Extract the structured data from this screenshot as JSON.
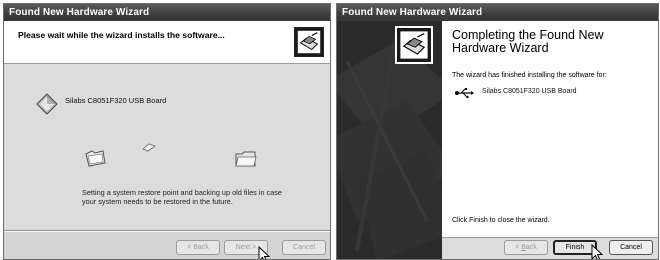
{
  "left_window": {
    "title": "Found New Hardware Wizard",
    "header_text": "Please wait while the wizard installs the software...",
    "device_name": "Silabs C8051F320 USB Board",
    "status_text": "Setting a system restore point and backing up old files in case your system needs to be restored in the future.",
    "buttons": {
      "back": {
        "label": "< Back",
        "enabled": false
      },
      "next": {
        "label": "Next >",
        "enabled": false
      },
      "cancel": {
        "label": "Cancel",
        "enabled": false
      }
    }
  },
  "right_window": {
    "title": "Found New Hardware Wizard",
    "heading": "Completing the Found New Hardware Wizard",
    "finished_text": "The wizard has finished installing the software for:",
    "device_name": "Silabs C8051F320 USB Board",
    "close_text": "Click Finish to close the wizard.",
    "buttons": {
      "back_prefix": "< ",
      "back_mnemonic": "B",
      "back_rest": "ack",
      "back_enabled": false,
      "finish": "Finish",
      "cancel": "Cancel"
    }
  },
  "colors": {
    "title_bar": "#404040",
    "panel_gray": "#dcdcdc",
    "side_band": "#2a2a2a"
  },
  "icons": [
    "hardware-wizard-icon",
    "device-diamond-icon",
    "folder-icon",
    "paper-flying-icon",
    "usb-icon",
    "mouse-pointer-icon"
  ]
}
